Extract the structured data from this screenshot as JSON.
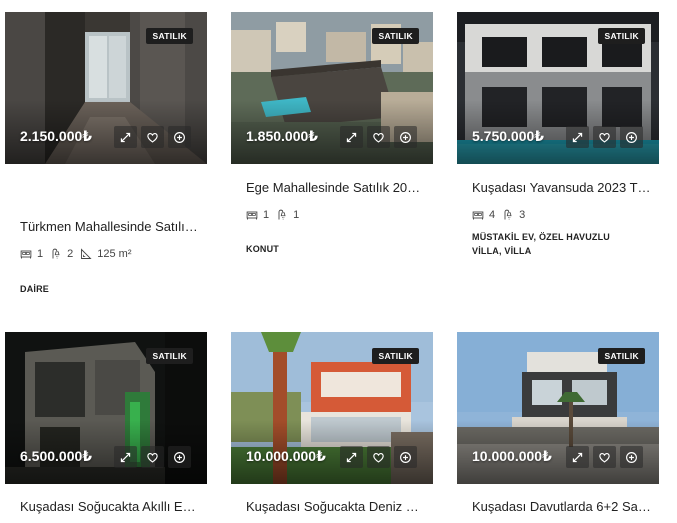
{
  "listings": [
    {
      "status": "SATILIK",
      "price": "2.150.000₺",
      "title": "Türkmen Mahallesinde Satılı…",
      "specs": {
        "rooms": "1",
        "baths": "2",
        "area": "125 m²"
      },
      "type_line1": "DAİRE",
      "type_line2": ""
    },
    {
      "status": "SATILIK",
      "price": "1.850.000₺",
      "title": "Ege Mahallesinde Satılık 20…",
      "specs": {
        "rooms": "1",
        "baths": "1"
      },
      "type_line1": "KONUT",
      "type_line2": ""
    },
    {
      "status": "SATILIK",
      "price": "5.750.000₺",
      "title": "Kuşadası Yavansuda 2023 T…",
      "specs": {
        "rooms": "4",
        "baths": "3"
      },
      "type_line1": "MÜSTAKİL EV, ÖZEL HAVUZLU",
      "type_line2": "VİLLA, VİLLA"
    },
    {
      "status": "SATILIK",
      "price": "6.500.000₺",
      "title": "Kuşadası Soğucakta Akıllı E…"
    },
    {
      "status": "SATILIK",
      "price": "10.000.000₺",
      "title": "Kuşadası Soğucakta Deniz …"
    },
    {
      "status": "SATILIK",
      "price": "10.000.000₺",
      "title": "Kuşadası Davutlarda 6+2 Sa…"
    }
  ],
  "icons": {
    "expand": "expand-icon",
    "favorite": "heart-icon",
    "compare": "plus-circle-icon",
    "bed": "bed-icon",
    "bath": "bath-icon",
    "area": "area-icon"
  },
  "colors": {
    "badge_bg": "#1e1e1e",
    "price_text": "#ffffff",
    "title_text": "#222222"
  }
}
